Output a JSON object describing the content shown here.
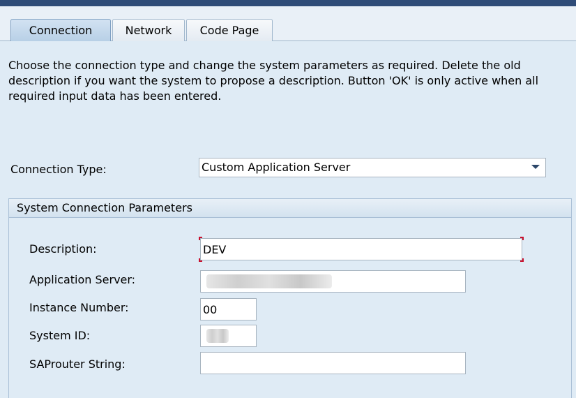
{
  "tabs": [
    {
      "label": "Connection",
      "active": true
    },
    {
      "label": "Network",
      "active": false
    },
    {
      "label": "Code Page",
      "active": false
    }
  ],
  "intro_text": "Choose the connection type and change the system parameters as required. Delete the old description if you want the system to propose a description. Button 'OK' is only active when all required input data has been entered.",
  "connection_type": {
    "label": "Connection Type:",
    "value": "Custom Application Server"
  },
  "system_params": {
    "header": "System Connection Parameters",
    "description": {
      "label": "Description:",
      "value": "DEV"
    },
    "application_server": {
      "label": "Application Server:",
      "value": ""
    },
    "instance_number": {
      "label": "Instance Number:",
      "value": "00"
    },
    "system_id": {
      "label": "System ID:",
      "value": ""
    },
    "saprouter": {
      "label": "SAProuter String:",
      "value": ""
    }
  },
  "colors": {
    "background": "#dfebf5",
    "topbar": "#2f4c78",
    "active_tab": "#b7cfe6",
    "focus_corner": "#c8102e"
  },
  "icons": {
    "dropdown": "chevron-down-icon"
  }
}
